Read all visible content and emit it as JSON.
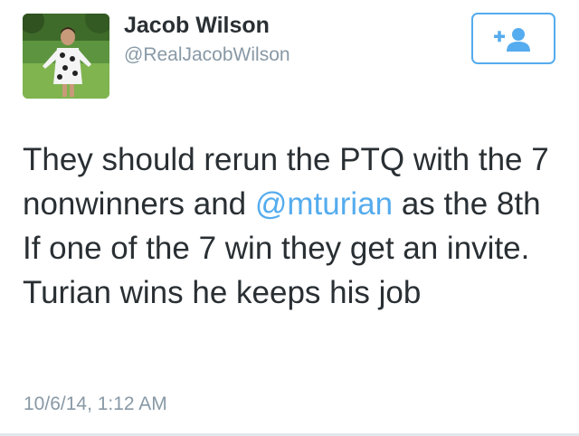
{
  "tweet": {
    "author": {
      "display_name": "Jacob Wilson",
      "handle": "@RealJacobWilson"
    },
    "follow_button": {
      "icon": "follow-user-icon",
      "accent_color": "#55acee"
    },
    "text_parts": {
      "before_mention": "They should rerun the PTQ with the 7 nonwinners and ",
      "mention": "@mturian",
      "after_mention": " as the 8th If one of the 7 win they get an invite. Turian wins he keeps his job"
    },
    "timestamp": "10/6/14, 1:12 AM"
  },
  "colors": {
    "text": "#292f33",
    "secondary": "#8899a6",
    "link": "#55acee"
  }
}
